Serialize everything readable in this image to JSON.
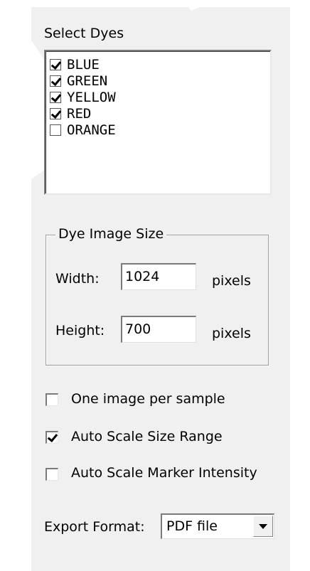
{
  "dyes": {
    "label": "Select Dyes",
    "items": [
      {
        "label": "BLUE",
        "checked": true
      },
      {
        "label": "GREEN",
        "checked": true
      },
      {
        "label": "YELLOW",
        "checked": true
      },
      {
        "label": "RED",
        "checked": true
      },
      {
        "label": "ORANGE",
        "checked": false
      }
    ]
  },
  "image_size": {
    "title": "Dye Image Size",
    "width_label": "Width:",
    "width_value": "1024",
    "height_label": "Height:",
    "height_value": "700",
    "unit": "pixels"
  },
  "options": [
    {
      "label": "One image per sample",
      "checked": false
    },
    {
      "label": "Auto Scale Size Range",
      "checked": true
    },
    {
      "label": "Auto Scale Marker Intensity",
      "checked": false
    }
  ],
  "export": {
    "label": "Export Format:",
    "value": "PDF file"
  }
}
